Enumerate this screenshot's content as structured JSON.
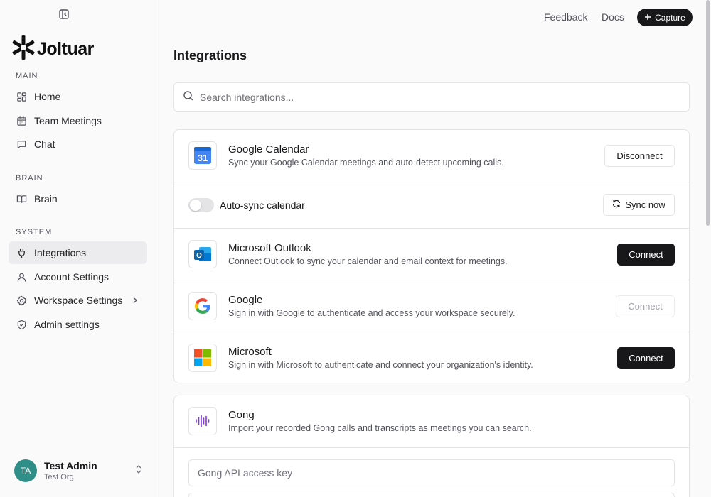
{
  "app": {
    "logo_text": "Joltuar"
  },
  "topbar": {
    "feedback": "Feedback",
    "docs": "Docs",
    "capture": "Capture"
  },
  "sidebar": {
    "sections": [
      {
        "label": "MAIN"
      },
      {
        "label": "BRAIN"
      },
      {
        "label": "SYSTEM"
      }
    ],
    "items": [
      {
        "label": "Home",
        "icon": "grid-icon"
      },
      {
        "label": "Team Meetings",
        "icon": "calendar-icon"
      },
      {
        "label": "Chat",
        "icon": "chat-icon"
      },
      {
        "label": "Brain",
        "icon": "book-icon"
      },
      {
        "label": "Integrations",
        "icon": "plug-icon",
        "active": true
      },
      {
        "label": "Account Settings",
        "icon": "user-icon"
      },
      {
        "label": "Workspace Settings",
        "icon": "gear-icon"
      },
      {
        "label": "Admin settings",
        "icon": "shield-icon"
      }
    ],
    "user": {
      "initials": "TA",
      "name": "Test Admin",
      "org": "Test Org"
    }
  },
  "main": {
    "title": "Integrations",
    "search_placeholder": "Search integrations...",
    "integrations": [
      {
        "name": "Google Calendar",
        "desc": "Sync your Google Calendar meetings and auto-detect upcoming calls.",
        "action": "Disconnect"
      },
      {
        "toggle_label": "Auto-sync calendar",
        "toggle_on": false,
        "action": "Sync now"
      },
      {
        "name": "Microsoft Outlook",
        "desc": "Connect Outlook to sync your calendar and email context for meetings.",
        "action": "Connect"
      },
      {
        "name": "Google",
        "desc": "Sign in with Google to authenticate and access your workspace securely.",
        "action": "Connect",
        "disabled": true
      },
      {
        "name": "Microsoft",
        "desc": "Sign in with Microsoft to authenticate and connect your organization's identity.",
        "action": "Connect"
      }
    ],
    "gong": {
      "name": "Gong",
      "desc": "Import your recorded Gong calls and transcripts as meetings you can search.",
      "api_key_placeholder": "Gong API access key"
    }
  },
  "colors": {
    "accent": "#18181b",
    "avatar": "#2f8f88",
    "gong": "#8039df"
  }
}
